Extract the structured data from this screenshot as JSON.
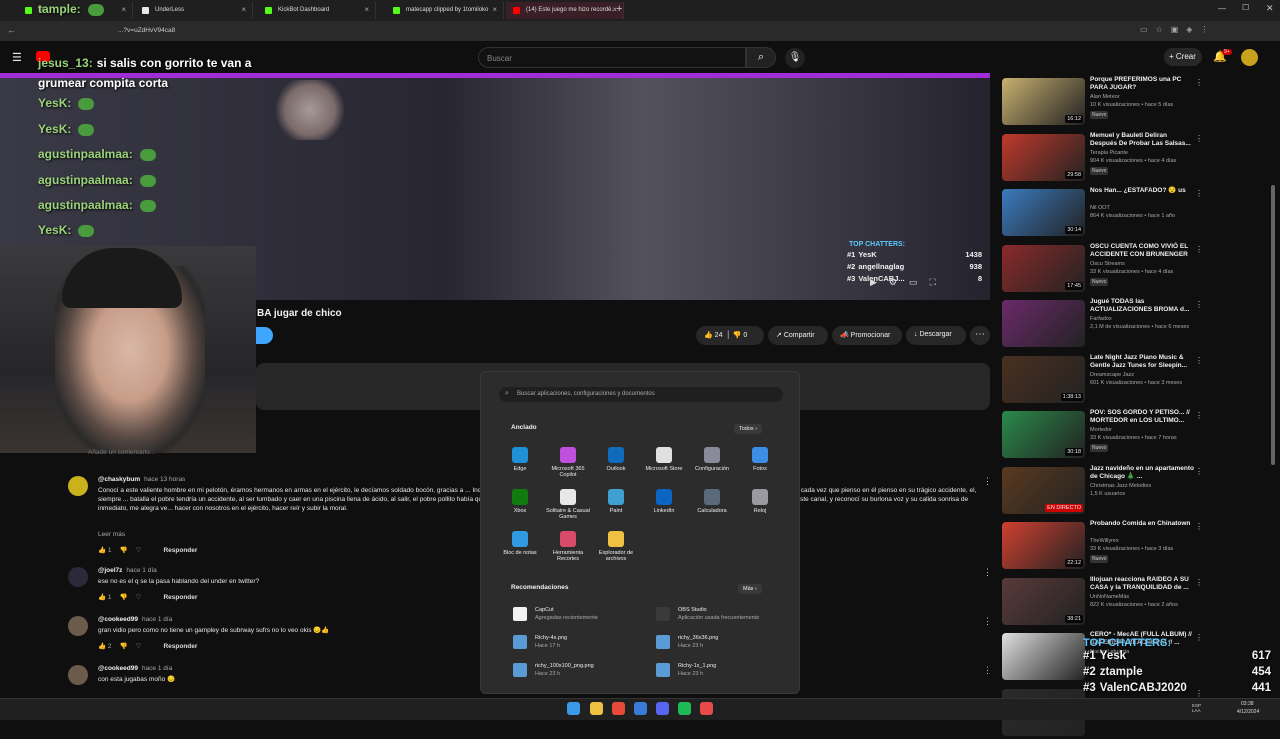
{
  "browser": {
    "tabs": [
      {
        "label": "St...",
        "favicon_color": "#53fc18",
        "active": false
      },
      {
        "label": "UnderLess",
        "favicon_color": "#e8e8e8",
        "active": false
      },
      {
        "label": "KickBot Dashboard",
        "favicon_color": "#53fc18",
        "active": false
      },
      {
        "label": "matecapp clipped by 1tomiloko",
        "favicon_color": "#53fc18",
        "active": false
      },
      {
        "label": "(14) Este juego me hizo recordé...",
        "favicon_color": "#ff0000",
        "active": true
      }
    ],
    "url": "...?v=uZdHvV94ca8"
  },
  "youtube": {
    "search_placeholder": "Buscar",
    "create_label": "Crear",
    "notif_count": "9+"
  },
  "chat_overlay": [
    {
      "user": "tample:",
      "text": ""
    },
    {
      "user": "jesus_13:",
      "text": "si salis con gorrito te van a grumear compita corta"
    },
    {
      "user": "YesK:",
      "text": ""
    },
    {
      "user": "YesK:",
      "text": ""
    },
    {
      "user": "agustinpaalmaa:",
      "text": ""
    },
    {
      "user": "agustinpaalmaa:",
      "text": ""
    },
    {
      "user": "agustinpaalmaa:",
      "text": ""
    },
    {
      "user": "YesK:",
      "text": ""
    }
  ],
  "top_chatters_small": {
    "title": "TOP CHATTERS:",
    "rows": [
      {
        "rank": "#1",
        "name": "YesK",
        "count": "1438"
      },
      {
        "rank": "#2",
        "name": "angellnaglag",
        "count": "938"
      },
      {
        "rank": "#3",
        "name": "ValenCABJ...",
        "count": "8"
      }
    ]
  },
  "video": {
    "title": "BA jugar de chico",
    "likes": "24",
    "dislikes": "0",
    "share_label": "Compartir",
    "promote_label": "Promocionar",
    "download_label": "Descargar"
  },
  "comments": {
    "add_placeholder": "Añade un comentario...",
    "items": [
      {
        "author": "@chaskybum",
        "time": "hace 13 horas",
        "text": "Conocí a este valiente hombre en mi pelotón, éramos hermanos en armas en el ejército, le decíamos soldado bocón, gracias a ... Incluso hoy en día en mis peores momentos le recuerdo y pienso en alguna broma que este genio haría. Aún así, cada vez que pienso en él pienso en su trágico accidente, el, siempre ... batalla el pobre tendría un accidente, al ser tumbado y caer en una piscina llena de ácido, al salir, el pobre pollito había quedado desplumado, cualquier rastro de pelo, desvaneciendo con ... O ese creí, hoy a mis 55 años encuentro este canal, y reconocí su burlona voz y su calida sonrisa de inmediato, me alegra ve... hacer con nosotros en el ejército, hacer reír y subir la moral.",
        "more": "Leer más",
        "likes": "1",
        "reply": "Responder",
        "avatar_color": "#c9b21b"
      },
      {
        "author": "@joel7z",
        "time": "hace 1 día",
        "text": "ese no es el q se la pasa hablando del under en twitter?",
        "likes": "1",
        "reply": "Responder",
        "avatar_color": "#2a2a3a"
      },
      {
        "author": "@cookeed99",
        "time": "hace 1 día",
        "text": "gran vidio pero como no tiene un gampley de subrway sufrs no lo veo okis 😔👍",
        "likes": "2",
        "reply": "Responder",
        "avatar_color": "#6b5b4b"
      },
      {
        "author": "@cookeed99",
        "time": "hace 1 día",
        "text": "con esta jugabas moño 😔",
        "likes": "",
        "reply": "",
        "avatar_color": "#6b5b4b"
      }
    ]
  },
  "start_menu": {
    "search_placeholder": "Buscar aplicaciones, configuraciones y documentos",
    "pinned_title": "Anclado",
    "all_label": "Todos",
    "pinned": [
      {
        "name": "Edge",
        "color": "#1f8fd6"
      },
      {
        "name": "Microsoft 365 Copilot",
        "color": "#c04fe0"
      },
      {
        "name": "Outlook",
        "color": "#0f6cbd"
      },
      {
        "name": "Microsoft Store",
        "color": "#e0e0e0"
      },
      {
        "name": "Configuración",
        "color": "#8a8a9a"
      },
      {
        "name": "Fotos",
        "color": "#3c8ee6"
      },
      {
        "name": "Xbox",
        "color": "#107c10"
      },
      {
        "name": "Solitaire & Casual Games",
        "color": "#e8e8e8"
      },
      {
        "name": "Paint",
        "color": "#3da0d0"
      },
      {
        "name": "LinkedIn",
        "color": "#0a66c2"
      },
      {
        "name": "Calculadora",
        "color": "#5a6a7a"
      },
      {
        "name": "Reloj",
        "color": "#9a9aa0"
      },
      {
        "name": "Bloc de notas",
        "color": "#2f9ae0"
      },
      {
        "name": "Herramienta Recortes",
        "color": "#d94a6a"
      },
      {
        "name": "Explorador de archivos",
        "color": "#f0c040"
      }
    ],
    "rec_title": "Recomendaciones",
    "more_label": "Más",
    "recommended": [
      {
        "name": "CapCut",
        "sub": "Agregadas recientemente",
        "color": "#f1f1f1"
      },
      {
        "name": "OBS Studio",
        "sub": "Aplicación usada frecuentemente",
        "color": "#3a3a3a"
      },
      {
        "name": "Richy-4s.png",
        "sub": "Hace 17 h",
        "color": "#5b9bd5"
      },
      {
        "name": "richy_36x36.png",
        "sub": "Hace 23 h",
        "color": "#5b9bd5"
      },
      {
        "name": "richy_100x100_png.png",
        "sub": "Hace 23 h",
        "color": "#5b9bd5"
      },
      {
        "name": "Richy-1x_1.png",
        "sub": "Hace 23 h",
        "color": "#5b9bd5"
      }
    ]
  },
  "related": [
    {
      "title": "Porque PREFERIMOS una PC PARA JUGAR?",
      "channel": "Alan Meteor",
      "meta": "10 K visualizaciones • hace 5 días",
      "badge": "Nuevo",
      "duration": "16:12",
      "thumb": "#c8b070"
    },
    {
      "title": "Memuel y Bauleti Deliran Después De Probar Las Salsas...",
      "channel": "Terapia Picante",
      "meta": "904 K visualizaciones • hace 4 días",
      "badge": "Nuevo",
      "duration": "29:58",
      "thumb": "#c0392b"
    },
    {
      "title": "Nos Han... ¿ESTAFADO? 😯 us",
      "channel": "Nil OOT",
      "meta": "864 K visualizaciones • hace 1 año",
      "badge": "",
      "duration": "30:14",
      "thumb": "#3b7bbf"
    },
    {
      "title": "OSCU CUENTA COMO VIVIÓ EL ACCIDENTE CON BRUNENGER",
      "channel": "Oscu Streams",
      "meta": "33 K visualizaciones • hace 4 días",
      "badge": "Nuevo",
      "duration": "17:45",
      "thumb": "#8a2a2a"
    },
    {
      "title": "Jugué TODAS las ACTUALIZACIONES BROMA d...",
      "channel": "Farfadox",
      "meta": "2,1 M de visualizaciones • hace 6 meses",
      "badge": "",
      "duration": "",
      "thumb": "#6a2a6a"
    },
    {
      "title": "Late Night Jazz Piano Music & Gentle Jazz Tunes for Sleepin...",
      "channel": "Dreamscape Jazz",
      "meta": "601 K visualizaciones • hace 3 meses",
      "badge": "",
      "duration": "1:38:13",
      "thumb": "#4a3020"
    },
    {
      "title": "POV: SOS GORDO Y PETISO... // MORTEDOR en LOS ULTIMO...",
      "channel": "Mortedor",
      "meta": "33 K visualizaciones • hace 7 horas",
      "badge": "Nuevo",
      "duration": "30:18",
      "thumb": "#2a8a4a"
    },
    {
      "title": "Jazz navideño en un apartamento de Chicago 🎄 ...",
      "channel": "Christmas Jazz Melodies",
      "meta": "1,5 K usuarios",
      "badge": "",
      "duration": "EN DIRECTO",
      "thumb": "#5a3a20"
    },
    {
      "title": "Probando Comida en Chinatown",
      "channel": "TheWillyrex",
      "meta": "33 K visualizaciones • hace 3 días",
      "badge": "Nuevo",
      "duration": "22:12",
      "thumb": "#d04030"
    },
    {
      "title": "Illojuan reacciona RAIDEO A SU CASA y la TRANQUILIDAD de ...",
      "channel": "UnNoNameMás",
      "meta": "822 K visualizaciones • hace 2 años",
      "badge": "",
      "duration": "38:21",
      "thumb": "#5a3a3a"
    },
    {
      "title": "CERO* - MecAE (FULL ALBUM) // BATERISTA REACCIONA // ...",
      "channel": "Nacho Lahuerta",
      "meta": "",
      "badge": "",
      "duration": "",
      "thumb": "#e0e0e0"
    },
    {
      "title": "",
      "channel": "",
      "meta": "",
      "badge": "",
      "duration": "",
      "thumb": "#2a2a2a"
    }
  ],
  "top_chatters_big": {
    "title": "TOP CHATTERS:",
    "rows": [
      {
        "rank": "#1",
        "name": "Yesk",
        "count": "617"
      },
      {
        "rank": "#2",
        "name": "ztample",
        "count": "454"
      },
      {
        "rank": "#3",
        "name": "ValenCABJ2020",
        "count": "441"
      }
    ]
  },
  "taskbar": {
    "time": "03:38",
    "date": "4/12/2024",
    "lang": "ESP LAA"
  }
}
